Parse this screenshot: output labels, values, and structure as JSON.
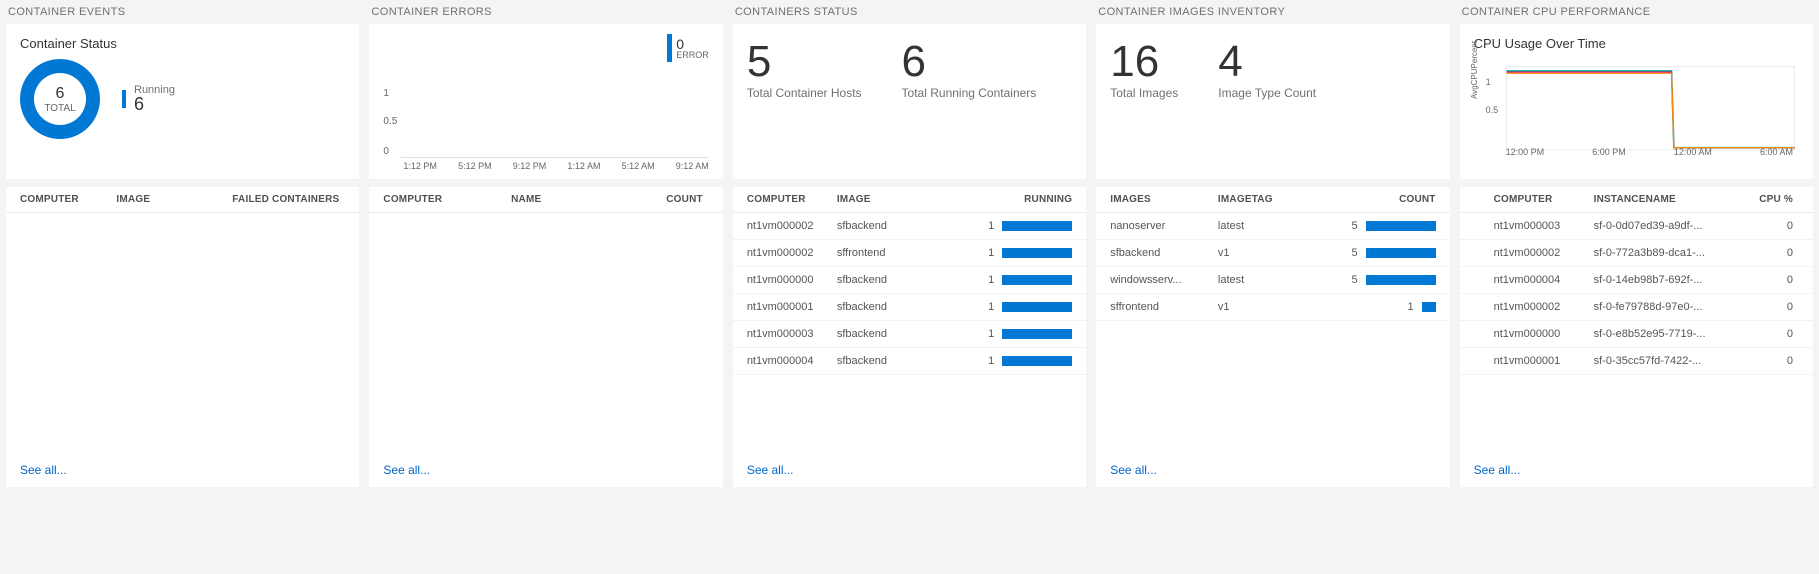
{
  "panels": {
    "events": {
      "title": "CONTAINER EVENTS",
      "card_title": "Container Status",
      "donut": {
        "value": "6",
        "total_label": "TOTAL"
      },
      "legend": {
        "label": "Running",
        "value": "6"
      },
      "columns": [
        "COMPUTER",
        "IMAGE",
        "FAILED CONTAINERS"
      ],
      "rows": [],
      "see_all": "See all..."
    },
    "errors": {
      "title": "CONTAINER ERRORS",
      "error_value": "0",
      "error_label": "ERROR",
      "y_ticks": [
        "1",
        "0.5",
        "0"
      ],
      "x_ticks": [
        "1:12 PM",
        "5:12 PM",
        "9:12 PM",
        "1:12 AM",
        "5:12 AM",
        "9:12 AM"
      ],
      "columns": [
        "COMPUTER",
        "NAME",
        "COUNT"
      ],
      "rows": [],
      "see_all": "See all..."
    },
    "status": {
      "title": "CONTAINERS STATUS",
      "stats": [
        {
          "value": "5",
          "label": "Total Container Hosts"
        },
        {
          "value": "6",
          "label": "Total Running Containers"
        }
      ],
      "columns": [
        "COMPUTER",
        "IMAGE",
        "RUNNING"
      ],
      "rows": [
        {
          "computer": "nt1vm000002",
          "image": "sfbackend",
          "running": 1,
          "bar": 70
        },
        {
          "computer": "nt1vm000002",
          "image": "sffrontend",
          "running": 1,
          "bar": 70
        },
        {
          "computer": "nt1vm000000",
          "image": "sfbackend",
          "running": 1,
          "bar": 70
        },
        {
          "computer": "nt1vm000001",
          "image": "sfbackend",
          "running": 1,
          "bar": 70
        },
        {
          "computer": "nt1vm000003",
          "image": "sfbackend",
          "running": 1,
          "bar": 70
        },
        {
          "computer": "nt1vm000004",
          "image": "sfbackend",
          "running": 1,
          "bar": 70
        }
      ],
      "see_all": "See all..."
    },
    "inventory": {
      "title": "CONTAINER IMAGES INVENTORY",
      "stats": [
        {
          "value": "16",
          "label": "Total Images"
        },
        {
          "value": "4",
          "label": "Image Type Count"
        }
      ],
      "columns": [
        "IMAGES",
        "IMAGETAG",
        "COUNT"
      ],
      "rows": [
        {
          "image": "nanoserver",
          "tag": "latest",
          "count": 5,
          "bar": 70
        },
        {
          "image": "sfbackend",
          "tag": "v1",
          "count": 5,
          "bar": 70
        },
        {
          "image": "windowsserv...",
          "tag": "latest",
          "count": 5,
          "bar": 70
        },
        {
          "image": "sffrontend",
          "tag": "v1",
          "count": 1,
          "bar": 14
        }
      ],
      "see_all": "See all..."
    },
    "cpu": {
      "title": "CONTAINER CPU PERFORMANCE",
      "card_title": "CPU Usage Over Time",
      "y_axis_label": "AvgCPUPercent",
      "y_ticks": [
        "1",
        "0.5"
      ],
      "x_ticks": [
        "12:00 PM",
        "6:00 PM",
        "12:00 AM",
        "6:00 AM"
      ],
      "columns": [
        "",
        "COMPUTER",
        "INSTANCENAME",
        "CPU %"
      ],
      "rows": [
        {
          "computer": "nt1vm000003",
          "instance": "sf-0-0d07ed39-a9df-...",
          "cpu": 0
        },
        {
          "computer": "nt1vm000002",
          "instance": "sf-0-772a3b89-dca1-...",
          "cpu": 0
        },
        {
          "computer": "nt1vm000004",
          "instance": "sf-0-14eb98b7-692f-...",
          "cpu": 0
        },
        {
          "computer": "nt1vm000002",
          "instance": "sf-0-fe79788d-97e0-...",
          "cpu": 0
        },
        {
          "computer": "nt1vm000000",
          "instance": "sf-0-e8b52e95-7719-...",
          "cpu": 0
        },
        {
          "computer": "nt1vm000001",
          "instance": "sf-0-35cc57fd-7422-...",
          "cpu": 0
        }
      ],
      "see_all": "See all..."
    }
  },
  "chart_data": [
    {
      "type": "pie",
      "title": "Container Status",
      "series": [
        {
          "name": "Running",
          "value": 6
        }
      ],
      "total": 6
    },
    {
      "type": "line",
      "title": "Container Errors",
      "x": [
        "1:12 PM",
        "5:12 PM",
        "9:12 PM",
        "1:12 AM",
        "5:12 AM",
        "9:12 AM"
      ],
      "series": [
        {
          "name": "ERROR",
          "values": [
            0,
            0,
            0,
            0,
            0,
            0
          ]
        }
      ],
      "ylabel": "",
      "ylim": [
        0,
        1
      ]
    },
    {
      "type": "line",
      "title": "CPU Usage Over Time",
      "x": [
        "12:00 PM",
        "6:00 PM",
        "12:00 AM",
        "6:00 AM"
      ],
      "series": [
        {
          "name": "nt1vm000003",
          "values": [
            1.2,
            1.2,
            1.2,
            0,
            0
          ]
        },
        {
          "name": "nt1vm000002",
          "values": [
            1.2,
            1.2,
            1.2,
            0,
            0
          ]
        },
        {
          "name": "nt1vm000004",
          "values": [
            1.2,
            1.2,
            1.2,
            0,
            0
          ]
        },
        {
          "name": "nt1vm000000",
          "values": [
            1.2,
            1.2,
            1.2,
            0,
            0
          ]
        },
        {
          "name": "nt1vm000001",
          "values": [
            1.2,
            1.2,
            1.2,
            0,
            0
          ]
        }
      ],
      "ylabel": "AvgCPUPercent",
      "ylim": [
        0,
        1.2
      ]
    }
  ]
}
